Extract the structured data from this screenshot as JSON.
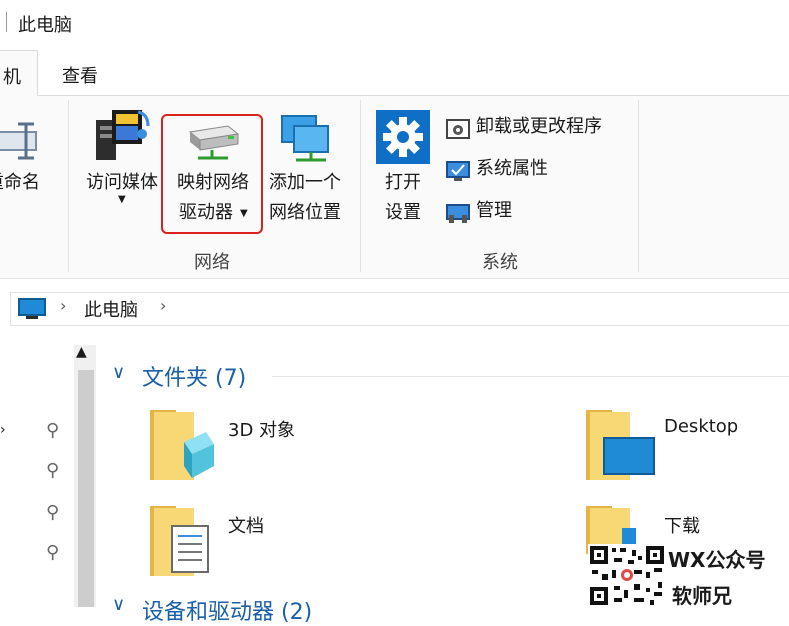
{
  "window": {
    "title": "此电脑"
  },
  "tabs": {
    "computer": "机",
    "view": "查看"
  },
  "ribbon": {
    "location_group": {
      "rename_label": "重命名"
    },
    "network_group": {
      "label": "网络",
      "media": {
        "label": "访问媒体",
        "icon": "media-server-icon"
      },
      "map_drive": {
        "line1": "映射网络",
        "line2": "驱动器",
        "icon": "network-drive-icon"
      },
      "add_location": {
        "line1": "添加一个",
        "line2": "网络位置",
        "icon": "network-location-icon"
      }
    },
    "system_group": {
      "label": "系统",
      "settings": {
        "line1": "打开",
        "line2": "设置",
        "icon": "gear-icon"
      },
      "uninstall": "卸载或更改程序",
      "properties": "系统属性",
      "manage": "管理"
    },
    "colors": {
      "highlight": "#d9221c",
      "settings_tile": "#0f6fc6"
    }
  },
  "address": {
    "path": [
      "此电脑"
    ],
    "icon": "monitor-icon"
  },
  "content": {
    "folders_section": "文件夹 (7)",
    "folders": [
      {
        "name": "3D 对象",
        "icon": "folder-3d-objects-icon"
      },
      {
        "name": "Desktop",
        "icon": "folder-desktop-icon"
      },
      {
        "name": "文档",
        "icon": "folder-documents-icon"
      },
      {
        "name": "下载",
        "icon": "folder-downloads-icon"
      }
    ],
    "devices_section": "设备和驱动器 (2)"
  },
  "watermark": {
    "line1": "WX公众号",
    "line2": "软师兄"
  }
}
